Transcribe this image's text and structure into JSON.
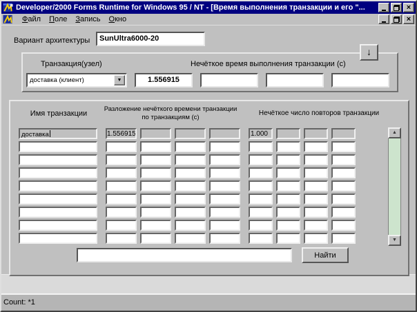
{
  "window": {
    "title": "Developer/2000 Forms Runtime for Windows 95 / NT - [Время выполнения транзакции и его \"..."
  },
  "menu": {
    "items": [
      {
        "label": "Файл"
      },
      {
        "label": "Поле"
      },
      {
        "label": "Запись"
      },
      {
        "label": "Окно"
      }
    ]
  },
  "form": {
    "architecture": {
      "label": "Вариант архитектуры",
      "value": "SunUltra6000-20"
    },
    "transaction_panel": {
      "node_label": "Транзакция(узел)",
      "time_label": "Нечёткое время выполнения  транзакции (с)",
      "dropdown_value": "доставка (клиент)",
      "time_values": [
        "1.556915",
        "",
        "",
        ""
      ]
    },
    "table": {
      "headers": {
        "name": "Имя транзакции",
        "decomposition_line1": "Разложение нечёткого времени транзакции",
        "decomposition_line2": "по транзакциям (с)",
        "repeats": "Нечёткое число повторов транзакции"
      },
      "rows": [
        {
          "name": "доставка",
          "decomposition": [
            "1.556915",
            "",
            "",
            ""
          ],
          "repeats": [
            "1.000",
            "",
            "",
            ""
          ]
        },
        {
          "name": "",
          "decomposition": [
            "",
            "",
            "",
            ""
          ],
          "repeats": [
            "",
            "",
            "",
            ""
          ]
        },
        {
          "name": "",
          "decomposition": [
            "",
            "",
            "",
            ""
          ],
          "repeats": [
            "",
            "",
            "",
            ""
          ]
        },
        {
          "name": "",
          "decomposition": [
            "",
            "",
            "",
            ""
          ],
          "repeats": [
            "",
            "",
            "",
            ""
          ]
        },
        {
          "name": "",
          "decomposition": [
            "",
            "",
            "",
            ""
          ],
          "repeats": [
            "",
            "",
            "",
            ""
          ]
        },
        {
          "name": "",
          "decomposition": [
            "",
            "",
            "",
            ""
          ],
          "repeats": [
            "",
            "",
            "",
            ""
          ]
        },
        {
          "name": "",
          "decomposition": [
            "",
            "",
            "",
            ""
          ],
          "repeats": [
            "",
            "",
            "",
            ""
          ]
        },
        {
          "name": "",
          "decomposition": [
            "",
            "",
            "",
            ""
          ],
          "repeats": [
            "",
            "",
            "",
            ""
          ]
        },
        {
          "name": "",
          "decomposition": [
            "",
            "",
            "",
            ""
          ],
          "repeats": [
            "",
            "",
            "",
            ""
          ]
        }
      ]
    },
    "search": {
      "value": "",
      "placeholder": "",
      "button_label": "Найти"
    }
  },
  "statusbar": {
    "count": "Count: *1"
  },
  "colors": {
    "titlebar": "#000080",
    "chrome": "#c0c0c0",
    "scroll_track": "#cde4cd",
    "status_bg": "#b5b5b5",
    "console_bg": "#dadada"
  }
}
